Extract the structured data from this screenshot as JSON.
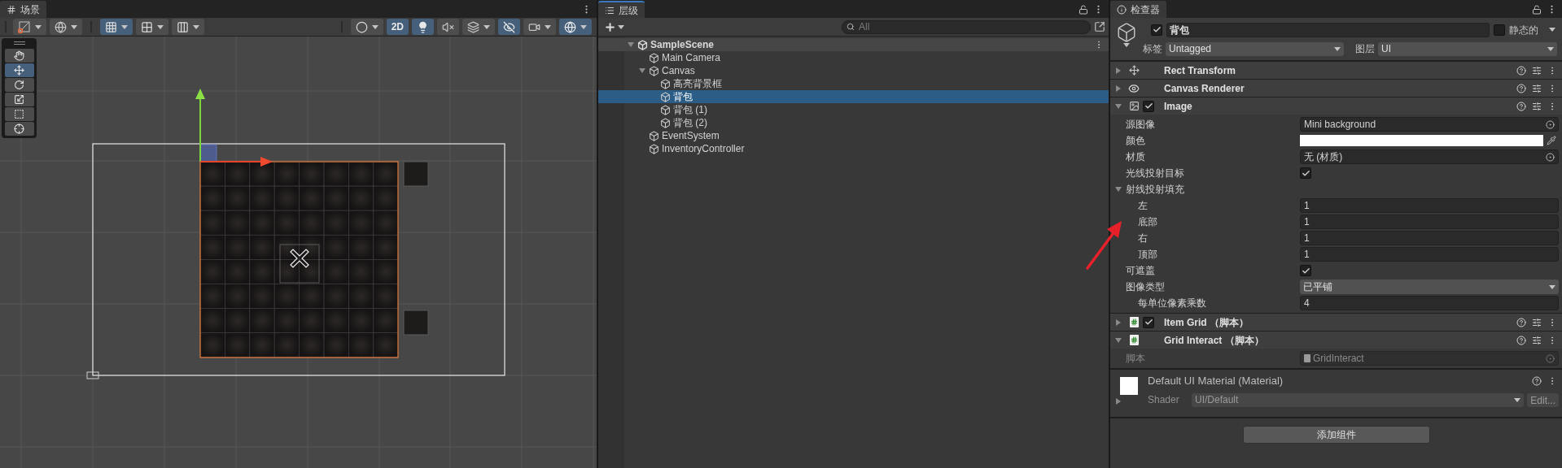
{
  "scene": {
    "tab": "场景",
    "toolbar_left": [
      {
        "selected": false,
        "dropdown": true
      },
      {
        "selected": false,
        "dropdown": true
      },
      {
        "selected": true,
        "dropdown": true
      },
      {
        "selected": false,
        "dropdown": true
      },
      {
        "selected": false,
        "dropdown": true
      }
    ],
    "toolbar_right": [
      {
        "selected": false,
        "dropdown": true
      },
      {
        "label": "2D",
        "selected": true,
        "dropdown": false
      },
      {
        "selected": true,
        "dropdown": false
      },
      {
        "selected": false,
        "dropdown": false
      },
      {
        "selected": false,
        "dropdown": true
      },
      {
        "selected": true,
        "dropdown": false
      },
      {
        "selected": false,
        "dropdown": true
      },
      {
        "selected": true,
        "dropdown": true
      }
    ],
    "tools": [
      {
        "selected": false
      },
      {
        "selected": true
      },
      {
        "selected": false
      },
      {
        "selected": false
      },
      {
        "selected": false
      },
      {
        "selected": false
      }
    ]
  },
  "hierarchy": {
    "tab": "层级",
    "search": {
      "placeholder": "All"
    },
    "tree": [
      {
        "name": "SampleScene",
        "kind": "scene",
        "expanded": true,
        "selected": false,
        "children": [
          {
            "name": "Main Camera",
            "selected": false
          },
          {
            "name": "Canvas",
            "expanded": true,
            "selected": false,
            "children": [
              {
                "name": "高亮背景框",
                "selected": false
              },
              {
                "name": "背包",
                "selected": true
              },
              {
                "name": "背包 (1)",
                "selected": false
              },
              {
                "name": "背包 (2)",
                "selected": false
              }
            ]
          },
          {
            "name": "EventSystem",
            "selected": false
          },
          {
            "name": "InventoryController",
            "selected": false
          }
        ]
      }
    ]
  },
  "inspector": {
    "tab": "检查器",
    "object": {
      "active": true,
      "name": "背包",
      "static": false,
      "static_label": "静态的",
      "tag_label": "标签",
      "tag": "Untagged",
      "layer_label": "图层",
      "layer": "UI"
    },
    "components": [
      {
        "kind": "transform",
        "name": "Rect Transform",
        "expanded": false
      },
      {
        "kind": "renderer",
        "name": "Canvas Renderer",
        "expanded": false
      },
      {
        "kind": "image",
        "name": "Image",
        "expanded": true,
        "enabled": true,
        "properties": [
          {
            "kind": "object",
            "label": "源图像",
            "value": "Mini background"
          },
          {
            "kind": "color",
            "label": "颜色",
            "color": "#ffffff"
          },
          {
            "kind": "object",
            "label": "材质",
            "value": "无 (材质)"
          },
          {
            "kind": "toggle",
            "label": "光线投射目标",
            "checked": true
          },
          {
            "kind": "foldout",
            "label": "射线投射填充",
            "expanded": true,
            "children": [
              {
                "kind": "number",
                "label": "左",
                "value": "1"
              },
              {
                "kind": "number",
                "label": "底部",
                "value": "1"
              },
              {
                "kind": "number",
                "label": "右",
                "value": "1"
              },
              {
                "kind": "number",
                "label": "顶部",
                "value": "1"
              }
            ]
          },
          {
            "kind": "toggle",
            "label": "可遮盖",
            "checked": true
          },
          {
            "kind": "dropdown",
            "label": "图像类型",
            "value": "已平铺",
            "children": [
              {
                "kind": "number",
                "label": "每单位像素乘数",
                "value": "4"
              }
            ]
          }
        ]
      },
      {
        "kind": "script",
        "name": "Item Grid （脚本）",
        "expanded": false,
        "enabled": true
      },
      {
        "kind": "script",
        "name": "Grid Interact （脚本）",
        "expanded": true,
        "properties": [
          {
            "kind": "script",
            "label": "脚本",
            "value": "GridInteract",
            "disabled": true
          }
        ]
      }
    ],
    "material": {
      "name": "Default UI Material (Material)",
      "expanded": false,
      "shader_label": "Shader",
      "shader": "UI/Default",
      "edit": "Edit..."
    },
    "add_component": "添加组件"
  }
}
